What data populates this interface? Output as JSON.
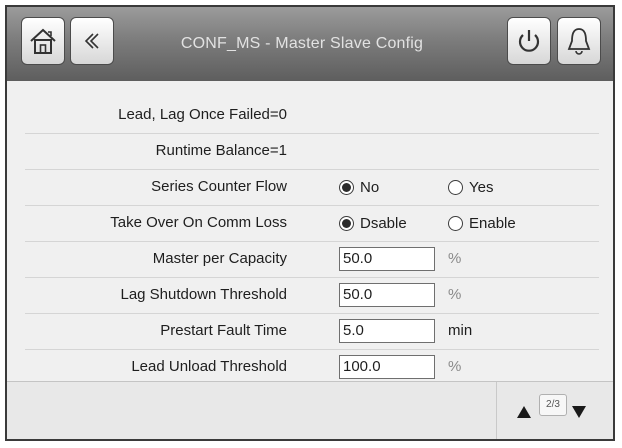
{
  "header": {
    "title": "CONF_MS  - Master Slave Config",
    "icons": [
      "home-icon",
      "back-icon",
      "power-icon",
      "alarm-bell-icon"
    ]
  },
  "rows": [
    {
      "label": "Lead, Lag Once Failed=0"
    },
    {
      "label": "Runtime Balance=1"
    },
    {
      "label": "Series Counter Flow",
      "options": [
        {
          "label": "No",
          "selected": true
        },
        {
          "label": "Yes",
          "selected": false
        }
      ]
    },
    {
      "label": "Take Over On Comm Loss",
      "options": [
        {
          "label": "Dsable",
          "selected": true
        },
        {
          "label": "Enable",
          "selected": false
        }
      ]
    },
    {
      "label": "Master per Capacity",
      "value": "50.0",
      "unit": "%"
    },
    {
      "label": "Lag Shutdown Threshold",
      "value": "50.0",
      "unit": "%"
    },
    {
      "label": "Prestart Fault Time",
      "value": "5.0",
      "unit": "min"
    },
    {
      "label": "Lead Unload Threshold",
      "value": "100.0",
      "unit": "%"
    }
  ],
  "footer": {
    "page": "2/3"
  },
  "colors": {
    "header_dark": "#5e5e5e",
    "unit_percent": "#8a8a8a",
    "unit_min": "#1e1e1e"
  }
}
